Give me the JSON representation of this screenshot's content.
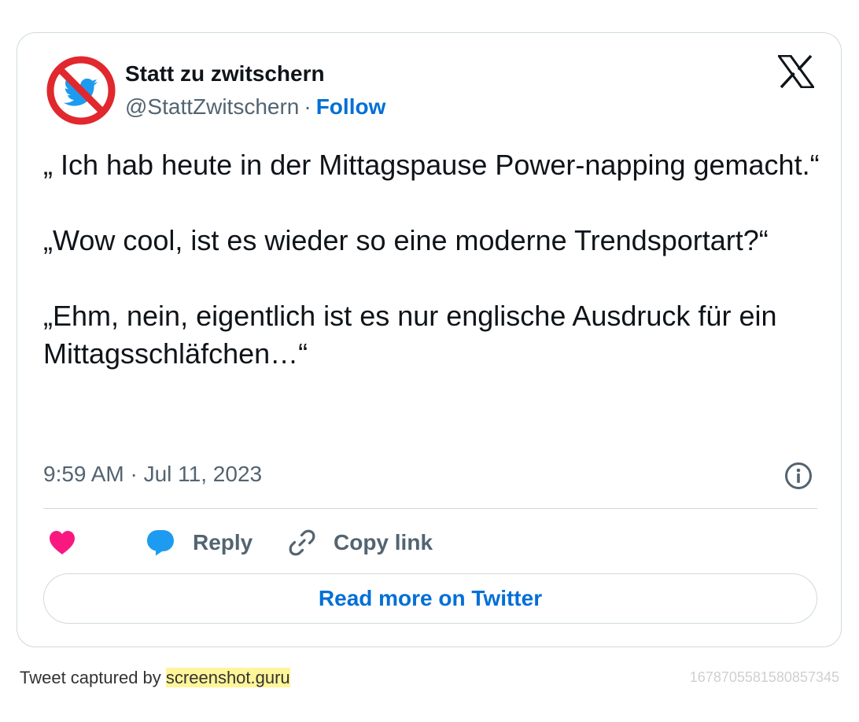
{
  "author": {
    "name": "Statt zu zwitschern",
    "handle": "@StattZwitschern",
    "separator": "·",
    "follow_label": "Follow",
    "avatar_icon": "no-bird-icon"
  },
  "platform_icon": "x-logo-icon",
  "tweet": {
    "paragraphs": [
      "„ Ich hab heute in der Mittagspause Power-napping gemacht.“",
      "„Wow cool, ist es wieder so eine moderne Trendsportart?“",
      "„Ehm, nein, eigentlich ist es nur englische Ausdruck für ein Mittagsschläfchen…“"
    ],
    "timestamp": "9:59 AM · Jul 11, 2023"
  },
  "actions": {
    "like_icon": "heart-icon",
    "reply_label": "Reply",
    "reply_icon": "speech-bubble-icon",
    "copy_label": "Copy link",
    "copy_icon": "link-icon",
    "info_icon": "info-icon"
  },
  "read_more_label": "Read more on Twitter",
  "footer": {
    "captured_prefix": "Tweet captured by",
    "captured_link": "screenshot.guru",
    "tweet_id": "1678705581580857345"
  },
  "colors": {
    "link_blue": "#006fd6",
    "muted_text": "#536471",
    "border": "#cfd9de",
    "heart": "#f91880",
    "reply_bubble": "#1d9bf0",
    "no_sign_red": "#e0282e",
    "highlight": "#fff59a"
  }
}
